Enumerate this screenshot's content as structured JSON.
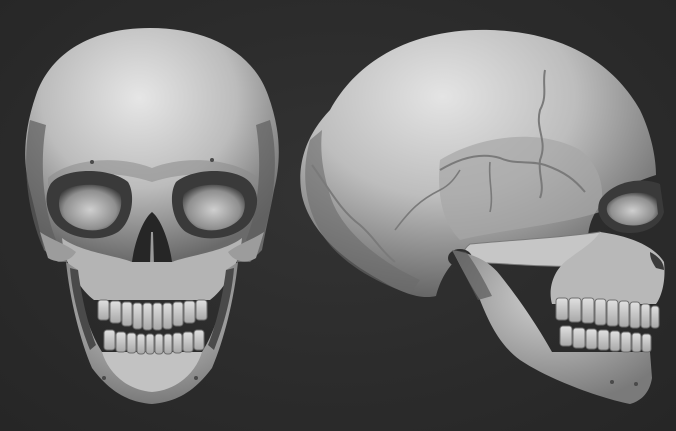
{
  "scene": {
    "background_color": "#2c2c2c",
    "bone_color": "#bdbdbd",
    "bone_highlight": "#e6e6e6",
    "bone_shadow": "#5e5e5e",
    "cavity_color": "#242424"
  },
  "views": [
    {
      "name": "front-view",
      "icon": "skull-front-icon"
    },
    {
      "name": "side-view",
      "icon": "skull-side-icon"
    }
  ]
}
